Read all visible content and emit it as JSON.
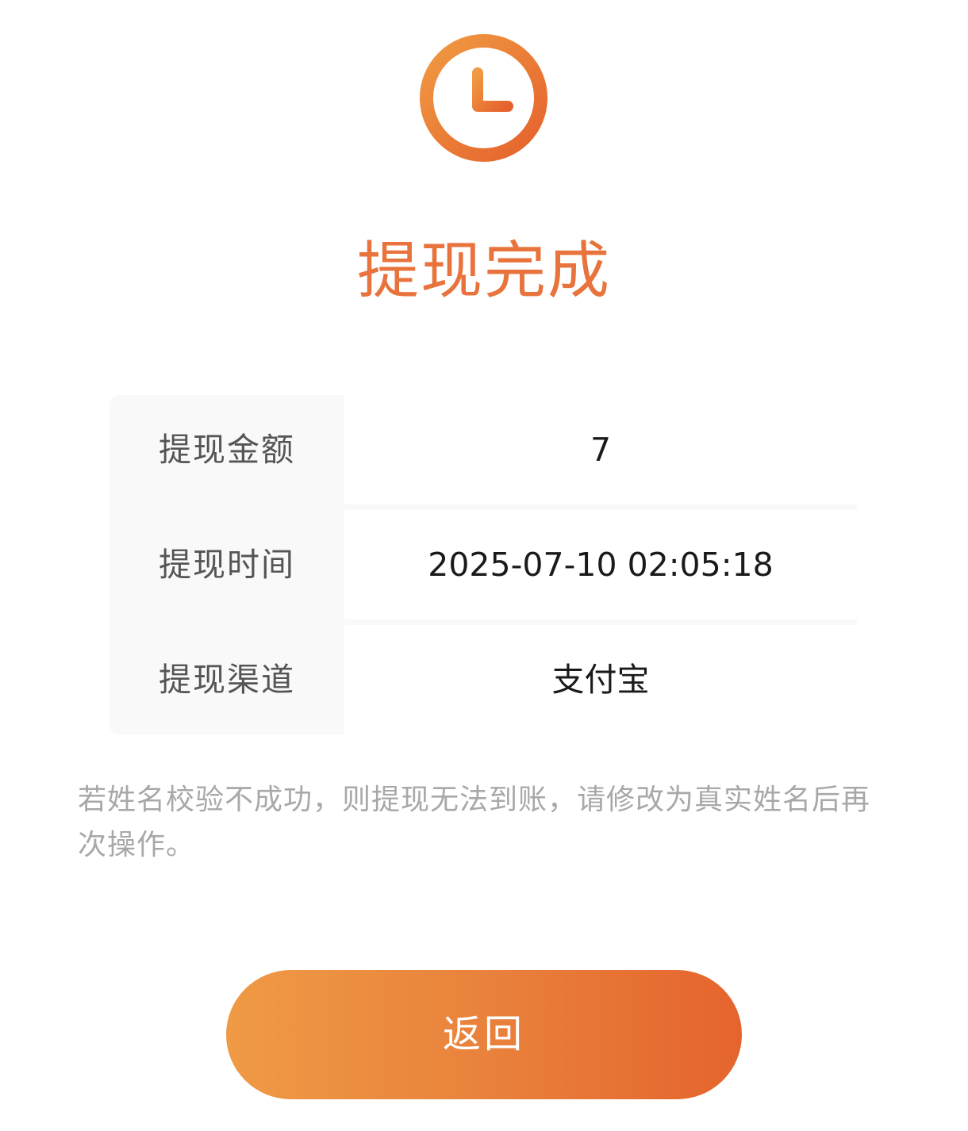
{
  "header": {
    "icon": "clock-icon",
    "title": "提现完成"
  },
  "details": {
    "rows": [
      {
        "label": "提现金额",
        "value": "7"
      },
      {
        "label": "提现时间",
        "value": "2025-07-10 02:05:18"
      },
      {
        "label": "提现渠道",
        "value": "支付宝"
      }
    ]
  },
  "notice": "若姓名校验不成功，则提现无法到账，请修改为真实姓名后再次操作。",
  "actions": {
    "back_label": "返回"
  },
  "colors": {
    "accent": "#e8733c",
    "gradient_start": "#ef9a45",
    "gradient_end": "#e5642d"
  }
}
